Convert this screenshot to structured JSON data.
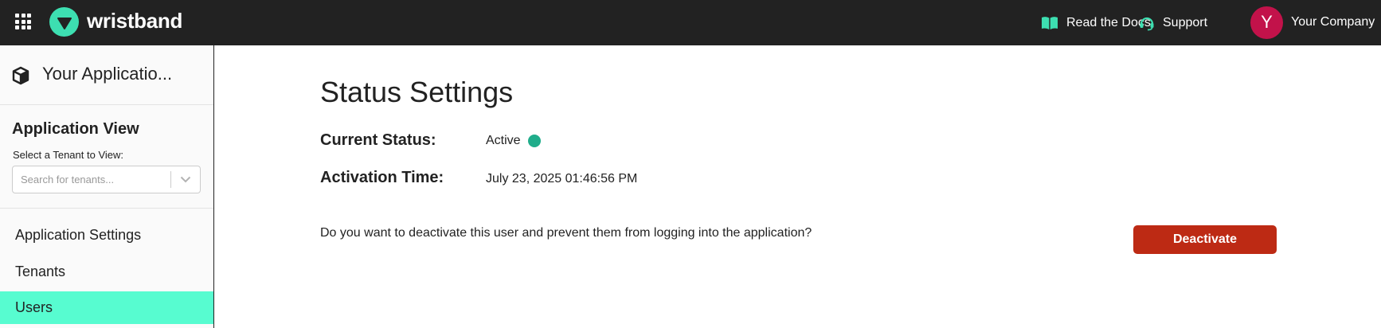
{
  "topbar": {
    "logo_text": "wristband",
    "docs_label": "Read the Docs",
    "support_label": "Support",
    "avatar_initial": "Y",
    "company_name": "Your Company"
  },
  "sidebar": {
    "app_name": "Your Applicatio...",
    "app_view_title": "Application View",
    "tenant_label": "Select a Tenant to View:",
    "tenant_placeholder": "Search for tenants...",
    "nav": [
      {
        "label": "Application Settings",
        "active": false
      },
      {
        "label": "Tenants",
        "active": false
      },
      {
        "label": "Users",
        "active": true
      }
    ]
  },
  "main": {
    "title": "Status Settings",
    "current_status_label": "Current Status:",
    "current_status_value": "Active",
    "activation_time_label": "Activation Time:",
    "activation_time_value": "July 23, 2025 01:46:56 PM",
    "deactivate_question": "Do you want to deactivate this user and prevent them from logging into the application?",
    "deactivate_button": "Deactivate"
  },
  "colors": {
    "topbar_bg": "#222222",
    "brand_mint": "#3ddfb1",
    "active_nav_bg": "#57fcd0",
    "avatar_bg": "#c2124a",
    "status_active": "#20ad8b",
    "danger_button": "#bd2a14"
  },
  "icons": {
    "apps": "grid-icon",
    "logo": "wristband-logo-icon",
    "docs": "book-icon",
    "support": "headset-icon",
    "application": "cube-icon",
    "select": "chevron-down-icon"
  }
}
